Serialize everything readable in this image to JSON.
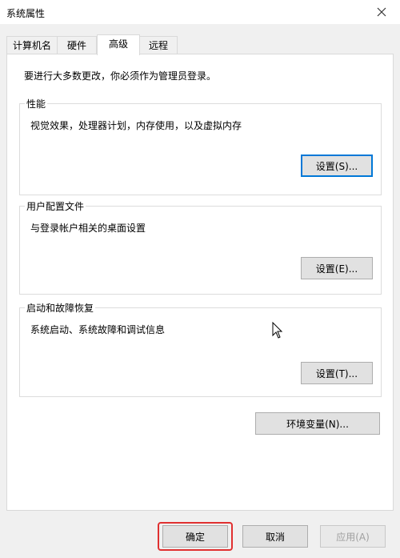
{
  "window": {
    "title": "系统属性"
  },
  "tabs": [
    {
      "label": "计算机名",
      "active": false
    },
    {
      "label": "硬件",
      "active": false
    },
    {
      "label": "高级",
      "active": true
    },
    {
      "label": "远程",
      "active": false
    }
  ],
  "panel": {
    "admin_note": "要进行大多数更改，你必须作为管理员登录。",
    "performance": {
      "title": "性能",
      "description": "视觉效果，处理器计划，内存使用，以及虚拟内存",
      "button": "设置(S)..."
    },
    "user_profiles": {
      "title": "用户配置文件",
      "description": "与登录帐户相关的桌面设置",
      "button": "设置(E)..."
    },
    "startup_recovery": {
      "title": "启动和故障恢复",
      "description": "系统启动、系统故障和调试信息",
      "button": "设置(T)..."
    },
    "env_button": "环境变量(N)..."
  },
  "footer": {
    "ok": "确定",
    "cancel": "取消",
    "apply": "应用(A)"
  },
  "colors": {
    "focus_border": "#0078d7",
    "highlight_box": "#e03030"
  },
  "icons": {
    "close": "close-icon",
    "cursor": "mouse-pointer-icon"
  }
}
